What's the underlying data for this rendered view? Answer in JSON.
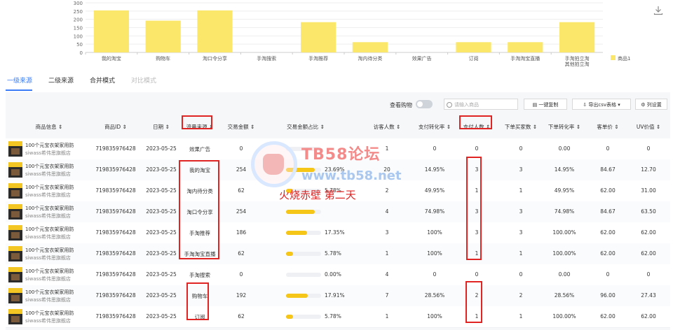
{
  "chart_data": {
    "type": "bar",
    "categories": [
      "我的淘宝",
      "购物车",
      "淘口令分享",
      "手淘搜索",
      "手淘推荐",
      "淘内待分类",
      "效果广告",
      "订阅",
      "手淘淘宝直播",
      "手淘拍立淘-其他拍立淘"
    ],
    "series": [
      {
        "name": "商品1",
        "values": [
          254,
          192,
          254,
          0,
          183,
          62,
          0,
          62,
          62,
          183
        ]
      }
    ],
    "yticks": [
      0,
      50,
      100,
      150,
      200,
      250,
      300
    ],
    "ylim": [
      0,
      300
    ],
    "legend": "right",
    "bar_color": "#fbe769"
  },
  "tabs": [
    {
      "label": "一级来源",
      "state": "active"
    },
    {
      "label": "二级来源",
      "state": "normal"
    },
    {
      "label": "合并模式",
      "state": "normal"
    },
    {
      "label": "对比模式",
      "state": "disabled"
    }
  ],
  "toolbar": {
    "view_label": "查看购物",
    "search_placeholder": "请输入商品",
    "copy_label": "一键复制",
    "export_label": "导出csv表格",
    "columns_label": "列设置"
  },
  "columns": [
    "商品信息",
    "商品ID",
    "日期",
    "流量来源",
    "交易金额",
    "交易金额占比",
    "访客人数",
    "支付转化率",
    "支付人数",
    "下单买家数",
    "下单转化率",
    "客单价",
    "UV价值"
  ],
  "rows": [
    {
      "name": "100个元宝衣架家用防",
      "shop": "siwass希伟思旗舰店",
      "id": "719835976428",
      "date": "2023-05-25",
      "source": "效果广告",
      "amount": "0",
      "share": 0.0,
      "share_text": "",
      "visitors": "1",
      "conv": "0",
      "payers": "0",
      "orders": "0",
      "order_conv": "0.00",
      "aov": "0",
      "uv": "0"
    },
    {
      "name": "100个元宝衣架家用防",
      "shop": "siwass希伟思旗舰店",
      "id": "719835976428",
      "date": "2023-05-25",
      "source": "我的淘宝",
      "amount": "254",
      "share": 0.2369,
      "share_text": "23.69%",
      "visitors": "20",
      "conv": "14.95%",
      "payers": "3",
      "orders": "3",
      "order_conv": "14.95%",
      "aov": "84.67",
      "uv": "12.70"
    },
    {
      "name": "100个元宝衣架家用防",
      "shop": "siwass希伟思旗舰店",
      "id": "719835976428",
      "date": "2023-05-25",
      "source": "淘内待分类",
      "amount": "62",
      "share": 0.0578,
      "share_text": "5.78%",
      "visitors": "2",
      "conv": "49.95%",
      "payers": "1",
      "orders": "1",
      "order_conv": "49.95%",
      "aov": "62.00",
      "uv": "31.00"
    },
    {
      "name": "100个元宝衣架家用防",
      "shop": "siwass希伟思旗舰店",
      "id": "719835976428",
      "date": "2023-05-25",
      "source": "淘口令分享",
      "amount": "254",
      "share": 0.2369,
      "share_text": "",
      "visitors": "4",
      "conv": "74.98%",
      "payers": "3",
      "orders": "3",
      "order_conv": "74.98%",
      "aov": "84.67",
      "uv": "63.50"
    },
    {
      "name": "100个元宝衣架家用防",
      "shop": "siwass希伟思旗舰店",
      "id": "719835976428",
      "date": "2023-05-25",
      "source": "手淘推荐",
      "amount": "186",
      "share": 0.1735,
      "share_text": "17.35%",
      "visitors": "3",
      "conv": "100%",
      "payers": "3",
      "orders": "3",
      "order_conv": "100.00%",
      "aov": "62.00",
      "uv": "62.00"
    },
    {
      "name": "100个元宝衣架家用防",
      "shop": "siwass希伟思旗舰店",
      "id": "719835976428",
      "date": "2023-05-25",
      "source": "手淘淘宝直播",
      "amount": "62",
      "share": 0.0578,
      "share_text": "5.78%",
      "visitors": "1",
      "conv": "100%",
      "payers": "1",
      "orders": "1",
      "order_conv": "100.00%",
      "aov": "62.00",
      "uv": "62.00"
    },
    {
      "name": "100个元宝衣架家用防",
      "shop": "siwass希伟思旗舰店",
      "id": "719835976428",
      "date": "2023-05-25",
      "source": "手淘搜索",
      "amount": "0",
      "share": 0.0,
      "share_text": "0.00%",
      "visitors": "4",
      "conv": "0",
      "payers": "0",
      "orders": "0",
      "order_conv": "0.00",
      "aov": "0",
      "uv": "0"
    },
    {
      "name": "100个元宝衣架家用防",
      "shop": "siwass希伟思旗舰店",
      "id": "719835976428",
      "date": "2023-05-25",
      "source": "购物车",
      "amount": "192",
      "share": 0.1791,
      "share_text": "17.91%",
      "visitors": "7",
      "conv": "28.56%",
      "payers": "2",
      "orders": "2",
      "order_conv": "28.56%",
      "aov": "96.00",
      "uv": "27.43"
    },
    {
      "name": "100个元宝衣架家用防",
      "shop": "siwass希伟思旗舰店",
      "id": "719835976428",
      "date": "2023-05-25",
      "source": "订阅",
      "amount": "62",
      "share": 0.0578,
      "share_text": "5.78%",
      "visitors": "1",
      "conv": "100%",
      "payers": "1",
      "orders": "1",
      "order_conv": "100.00%",
      "aov": "62.00",
      "uv": "62.00"
    }
  ],
  "watermark": {
    "title": "TB58论坛",
    "url": "www.tb58.net",
    "annotation": "火烧赤壁 第二天"
  }
}
